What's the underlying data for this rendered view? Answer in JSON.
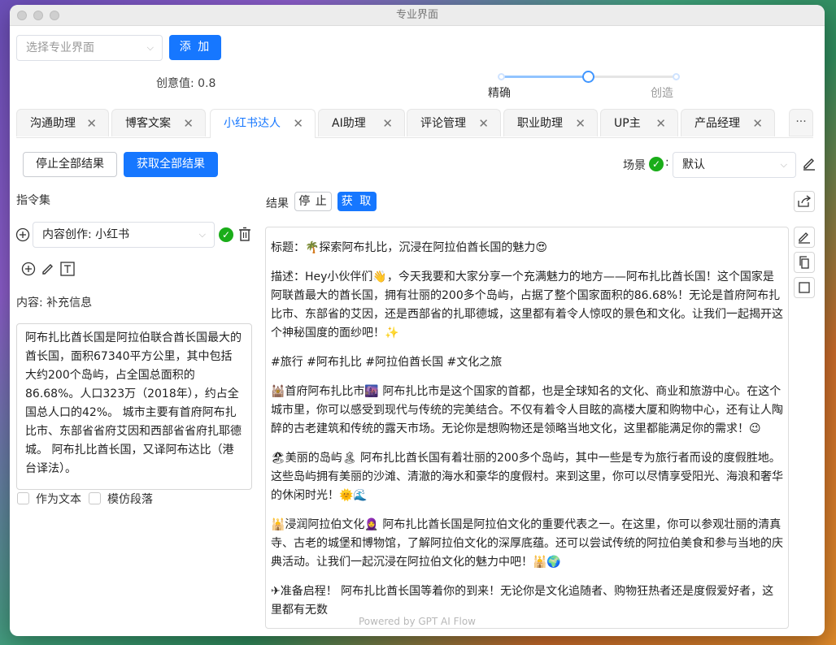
{
  "window": {
    "title": "专业界面"
  },
  "toolbar": {
    "select_placeholder": "选择专业界面",
    "add_label": "添 加",
    "creativity_label": "创意值: 0.8",
    "slider_left": "精确",
    "slider_right": "创造",
    "slider_value": 0.5
  },
  "tabs": [
    {
      "label": "沟通助理"
    },
    {
      "label": "博客文案"
    },
    {
      "label": "小红书达人",
      "active": true
    },
    {
      "label": "AI助理"
    },
    {
      "label": "评论管理"
    },
    {
      "label": "职业助理"
    },
    {
      "label": "UP主"
    },
    {
      "label": "产品经理"
    }
  ],
  "tabs_more": "···",
  "actions": {
    "stop_all": "停止全部结果",
    "get_all": "获取全部结果",
    "scene_label": "场景",
    "scene_value": "默认"
  },
  "left": {
    "command_set": "指令集",
    "command_value": "内容创作: 小红书",
    "content_label": "内容: 补充信息",
    "content_text": "阿布扎比酋长国是阿拉伯联合酋长国最大的酋长国，面积67340平方公里，其中包括大约200个岛屿，占全国总面积的86.68%。人口323万（2018年），约占全国总人口的42%。 城市主要有首府阿布扎比市、东部省省府艾因和西部省省府扎耶德城。 阿布扎比酋长国，又译阿布达比（港台译法）。",
    "as_text": "作为文本",
    "imitate": "模仿段落"
  },
  "result": {
    "label": "结果",
    "stop": "停 止",
    "get": "获 取",
    "paragraphs": [
      "标题：🌴探索阿布扎比，沉浸在阿拉伯酋长国的魅力😍",
      "描述：Hey小伙伴们👋，今天我要和大家分享一个充满魅力的地方——阿布扎比酋长国！这个国家是阿联酋最大的酋长国，拥有壮丽的200多个岛屿，占据了整个国家面积的86.68%！无论是首府阿布扎比市、东部省的艾因，还是西部省的扎耶德城，这里都有着令人惊叹的景色和文化。让我们一起揭开这个神秘国度的面纱吧！✨",
      "#旅行 #阿布扎比 #阿拉伯酋长国 #文化之旅",
      "🕍首府阿布扎比市🌆 阿布扎比市是这个国家的首都，也是全球知名的文化、商业和旅游中心。在这个城市里，你可以感受到现代与传统的完美结合。不仅有着令人目眩的高楼大厦和购物中心，还有让人陶醉的古老建筑和传统的露天市场。无论你是想购物还是领略当地文化，这里都能满足你的需求！😉",
      "🏖美丽的岛屿🏝 阿布扎比酋长国有着壮丽的200多个岛屿，其中一些是专为旅行者而设的度假胜地。这些岛屿拥有美丽的沙滩、清澈的海水和豪华的度假村。来到这里，你可以尽情享受阳光、海浪和奢华的休闲时光！🌞🌊",
      "🕌浸润阿拉伯文化🧕 阿布扎比酋长国是阿拉伯文化的重要代表之一。在这里，你可以参观壮丽的清真寺、古老的城堡和博物馆，了解阿拉伯文化的深厚底蕴。还可以尝试传统的阿拉伯美食和参与当地的庆典活动。让我们一起沉浸在阿拉伯文化的魅力中吧！🕌🌍",
      "✈准备启程！ 阿布扎比酋长国等着你的到来！无论你是文化追随者、购物狂热者还是度假爱好者，这里都有无数"
    ]
  },
  "footer": "Powered by GPT AI Flow",
  "colors": {
    "primary": "#1677ff",
    "green": "#1aad19"
  }
}
